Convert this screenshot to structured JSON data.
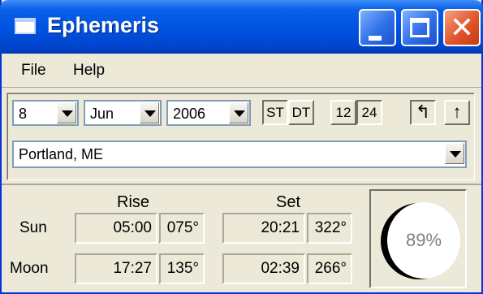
{
  "window": {
    "title": "Ephemeris"
  },
  "menu": {
    "file": "File",
    "help": "Help"
  },
  "date": {
    "day": "8",
    "month": "Jun",
    "year": "2006"
  },
  "toggles": {
    "st": "ST",
    "dt": "DT",
    "h12": "12",
    "h24": "24",
    "arrow_left": "↰",
    "arrow_up": "↑"
  },
  "location": {
    "value": "Portland, ME"
  },
  "table": {
    "rise_header": "Rise",
    "set_header": "Set",
    "rows": [
      {
        "label": "Sun",
        "rise_time": "05:00",
        "rise_az": "075°",
        "set_time": "20:21",
        "set_az": "322°"
      },
      {
        "label": "Moon",
        "rise_time": "17:27",
        "rise_az": "135°",
        "set_time": "02:39",
        "set_az": "266°"
      }
    ]
  },
  "moon_phase": {
    "percent_label": "89%",
    "illumination": 0.89
  },
  "colors": {
    "titlebar": "#0054e3",
    "window_bg": "#ece9d8",
    "close_button": "#e2552b"
  }
}
